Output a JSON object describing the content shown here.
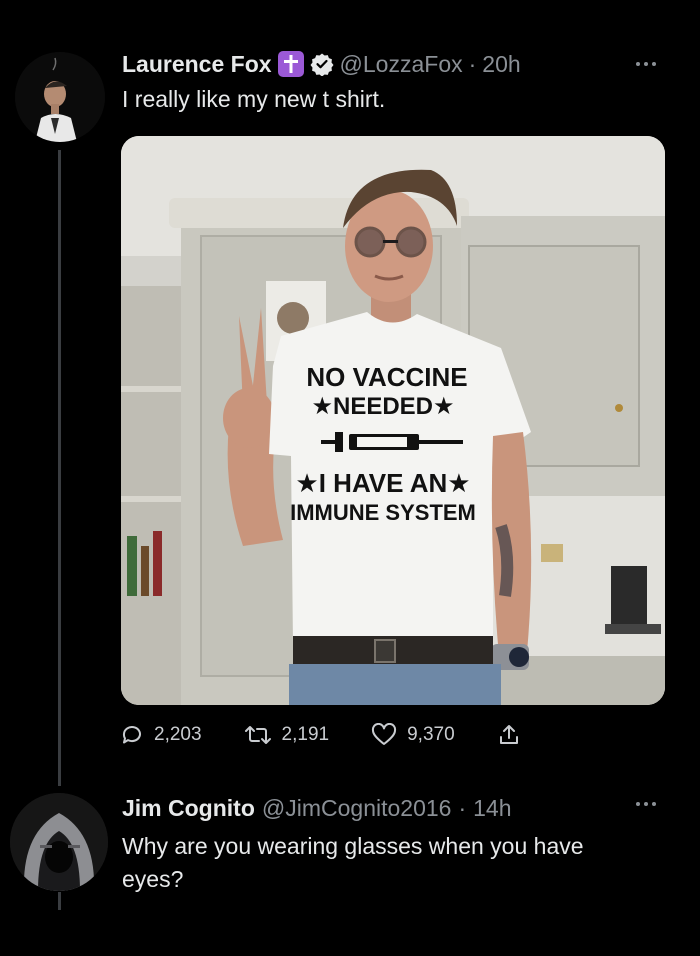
{
  "tweet": {
    "author_name": "Laurence Fox",
    "handle": "@LozzaFox",
    "separator": "·",
    "time": "20h",
    "text": "I really like my new t shirt.",
    "avatar_icon": "profile-photo-avatar",
    "badge_icon": "cross-badge-icon",
    "verified_icon": "verified-badge-icon",
    "image": {
      "description_icon": "tweet-photo",
      "shirt_lines": [
        "NO VACCINE",
        "★NEEDED★",
        "★I HAVE AN★",
        "IMMUNE SYSTEM"
      ]
    },
    "actions": {
      "replies": "2,203",
      "retweets": "2,191",
      "likes": "9,370"
    }
  },
  "reply": {
    "author_name": "Jim Cognito",
    "handle": "@JimCognito2016",
    "separator": "·",
    "time": "14h",
    "text": "Why are you wearing glasses when you have eyes?"
  },
  "colors": {
    "background": "#000000",
    "text_primary": "#e7e9ea",
    "text_secondary": "#8b9096",
    "thread_line": "#3a3d41",
    "badge_purple": "#9b59d6"
  }
}
